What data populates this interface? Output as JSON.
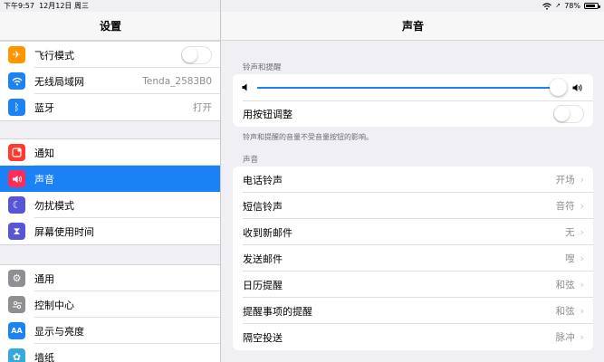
{
  "status": {
    "time": "下午9:57",
    "date": "12月12日 周三",
    "battery": "78%"
  },
  "master": {
    "title": "设置",
    "group1": [
      {
        "label": "飞行模式",
        "icon": "airplane-icon",
        "color": "#ff9500",
        "glyph": "✈"
      },
      {
        "label": "无线局域网",
        "icon": "wifi-icon",
        "color": "#1b82f5",
        "glyph": "◠",
        "value": "Tenda_2583B0"
      },
      {
        "label": "蓝牙",
        "icon": "bluetooth-icon",
        "color": "#1b82f5",
        "glyph": "ᛒ",
        "value": "打开"
      }
    ],
    "group2": [
      {
        "label": "通知",
        "icon": "notifications-icon",
        "color": "#ff3b30",
        "glyph": "▣"
      },
      {
        "label": "声音",
        "icon": "speaker-icon",
        "color": "#ff2d55",
        "glyph": "🔊"
      },
      {
        "label": "勿扰模式",
        "icon": "moon-icon",
        "color": "#5856d6",
        "glyph": "☾"
      },
      {
        "label": "屏幕使用时间",
        "icon": "hourglass-icon",
        "color": "#5856d6",
        "glyph": "⧗"
      }
    ],
    "group3": [
      {
        "label": "通用",
        "icon": "gear-icon",
        "color": "#8e8e93",
        "glyph": "⚙"
      },
      {
        "label": "控制中心",
        "icon": "control-center-icon",
        "color": "#8e8e93",
        "glyph": "◉"
      },
      {
        "label": "显示与亮度",
        "icon": "display-icon",
        "color": "#1b82f5",
        "glyph": "AA"
      },
      {
        "label": "墙纸",
        "icon": "wallpaper-icon",
        "color": "#34aadc",
        "glyph": "✿"
      }
    ]
  },
  "detail": {
    "title": "声音",
    "ringer_section": "铃声和提醒",
    "volume_fraction": 0.98,
    "button_adjust_label": "用按钮调整",
    "footnote": "铃声和提醒的音量不受音量按钮的影响。",
    "sounds_section": "声音",
    "sounds": [
      {
        "label": "电话铃声",
        "value": "开场"
      },
      {
        "label": "短信铃声",
        "value": "音符"
      },
      {
        "label": "收到新邮件",
        "value": "无"
      },
      {
        "label": "发送邮件",
        "value": "嗖"
      },
      {
        "label": "日历提醒",
        "value": "和弦"
      },
      {
        "label": "提醒事项的提醒",
        "value": "和弦"
      },
      {
        "label": "隔空投送",
        "value": "脉冲"
      }
    ]
  },
  "colors": {
    "accent": "#1b82f5",
    "background": "#efeff4"
  }
}
